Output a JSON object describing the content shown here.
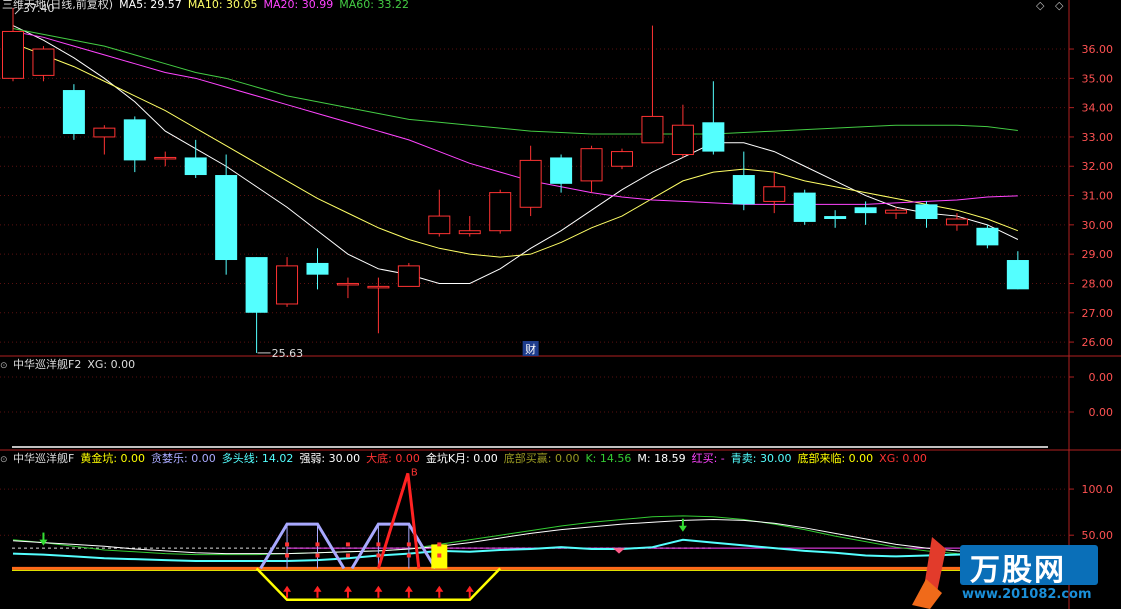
{
  "main": {
    "title": "三维天地(日线,前复权)",
    "ma": [
      {
        "label": "MA5: 29.57",
        "color": "#ffffff"
      },
      {
        "label": "MA10: 30.05",
        "color": "#ffff66"
      },
      {
        "label": "MA20: 30.99",
        "color": "#ff44ff"
      },
      {
        "label": "MA60: 33.22",
        "color": "#44cc44"
      }
    ],
    "high_label": "37.40",
    "low_label": "25.63",
    "event_marker": "财",
    "y_ticks": [
      "36.00",
      "35.00",
      "34.00",
      "33.00",
      "32.00",
      "31.00",
      "30.00",
      "29.00",
      "28.00",
      "27.00",
      "26.00"
    ],
    "y_tick_values": [
      36,
      35,
      34,
      33,
      32,
      31,
      30,
      29,
      28,
      27,
      26
    ],
    "price_range": [
      25.9,
      37.4
    ],
    "up_color": "#ff3333",
    "down_color": "#54ffff"
  },
  "panel2": {
    "title": "中华巡洋舰F2",
    "xg": "XG: 0.00",
    "y_ticks": [
      "0.00",
      "0.00"
    ]
  },
  "panel3": {
    "title": "中华巡洋舰F",
    "items": [
      {
        "label": "黄金坑:",
        "value": "0.00",
        "color": "#ffff00"
      },
      {
        "label": "贪婪乐:",
        "value": "0.00",
        "color": "#aaaaff"
      },
      {
        "label": "多头线:",
        "value": "14.02",
        "color": "#54ffff"
      },
      {
        "label": "强弱:",
        "value": "30.00",
        "color": "#ffffff"
      },
      {
        "label": "大底:",
        "value": "0.00",
        "color": "#ff3333"
      },
      {
        "label": "金坑K月:",
        "value": "0.00",
        "color": "#ffffff"
      },
      {
        "label": "底部买赢:",
        "value": "0.00",
        "color": "#999922"
      },
      {
        "label": "K:",
        "value": "14.56",
        "color": "#33cc33"
      },
      {
        "label": "M:",
        "value": "18.59",
        "color": "#ffffff"
      },
      {
        "label": "红买:",
        "value": "-",
        "color": "#ff44ff"
      },
      {
        "label": "青卖:",
        "value": "30.00",
        "color": "#54ffff"
      },
      {
        "label": "底部来临:",
        "value": "0.00",
        "color": "#ffff00"
      },
      {
        "label": "XG:",
        "value": "0.00",
        "color": "#ff3333"
      }
    ],
    "y_ticks": [
      "100.0",
      "50.00"
    ],
    "y_tick_values": [
      100,
      50
    ],
    "b_marker": "B"
  },
  "watermark": {
    "brand": "万股网",
    "url": "www.201082.com"
  },
  "candles": [
    {
      "o": 35.0,
      "c": 36.6,
      "h": 37.4,
      "l": 34.9
    },
    {
      "o": 35.1,
      "c": 36.0,
      "h": 36.1,
      "l": 34.9
    },
    {
      "o": 34.6,
      "c": 33.1,
      "h": 34.8,
      "l": 32.9
    },
    {
      "o": 33.0,
      "c": 33.3,
      "h": 33.4,
      "l": 32.4
    },
    {
      "o": 33.6,
      "c": 32.2,
      "h": 33.7,
      "l": 31.8
    },
    {
      "o": 32.3,
      "c": 32.3,
      "h": 32.5,
      "l": 32.0
    },
    {
      "o": 32.3,
      "c": 31.7,
      "h": 32.9,
      "l": 31.6
    },
    {
      "o": 31.7,
      "c": 28.8,
      "h": 32.4,
      "l": 28.3
    },
    {
      "o": 28.9,
      "c": 27.0,
      "h": 28.9,
      "l": 25.63
    },
    {
      "o": 27.3,
      "c": 28.6,
      "h": 28.9,
      "l": 27.2
    },
    {
      "o": 28.7,
      "c": 28.3,
      "h": 29.2,
      "l": 27.8
    },
    {
      "o": 28.0,
      "c": 28.0,
      "h": 28.2,
      "l": 27.5
    },
    {
      "o": 27.9,
      "c": 27.9,
      "h": 28.2,
      "l": 26.3
    },
    {
      "o": 27.9,
      "c": 28.6,
      "h": 28.7,
      "l": 27.9
    },
    {
      "o": 29.7,
      "c": 30.3,
      "h": 31.2,
      "l": 29.6
    },
    {
      "o": 29.7,
      "c": 29.8,
      "h": 30.3,
      "l": 29.6
    },
    {
      "o": 29.8,
      "c": 31.1,
      "h": 31.2,
      "l": 29.7
    },
    {
      "o": 30.6,
      "c": 32.2,
      "h": 32.7,
      "l": 30.3
    },
    {
      "o": 32.3,
      "c": 31.4,
      "h": 32.4,
      "l": 31.1
    },
    {
      "o": 31.5,
      "c": 32.6,
      "h": 32.7,
      "l": 31.1
    },
    {
      "o": 32.0,
      "c": 32.5,
      "h": 32.6,
      "l": 31.9
    },
    {
      "o": 32.8,
      "c": 33.7,
      "h": 36.8,
      "l": 32.8
    },
    {
      "o": 32.4,
      "c": 33.4,
      "h": 34.1,
      "l": 32.3
    },
    {
      "o": 33.5,
      "c": 32.5,
      "h": 34.9,
      "l": 32.4
    },
    {
      "o": 31.7,
      "c": 30.7,
      "h": 32.5,
      "l": 30.5
    },
    {
      "o": 30.8,
      "c": 31.3,
      "h": 31.8,
      "l": 30.4
    },
    {
      "o": 31.1,
      "c": 30.1,
      "h": 31.2,
      "l": 30.0
    },
    {
      "o": 30.3,
      "c": 30.2,
      "h": 30.5,
      "l": 29.9
    },
    {
      "o": 30.6,
      "c": 30.4,
      "h": 30.8,
      "l": 30.0
    },
    {
      "o": 30.4,
      "c": 30.5,
      "h": 30.6,
      "l": 30.2
    },
    {
      "o": 30.7,
      "c": 30.2,
      "h": 30.8,
      "l": 29.9
    },
    {
      "o": 30.0,
      "c": 30.2,
      "h": 30.4,
      "l": 29.8
    },
    {
      "o": 29.9,
      "c": 29.3,
      "h": 30.0,
      "l": 29.2
    },
    {
      "o": 28.8,
      "c": 27.8,
      "h": 29.1,
      "l": 27.8
    }
  ],
  "ma_series": {
    "ma5": [
      36.8,
      36.3,
      35.7,
      35.0,
      34.2,
      33.2,
      32.6,
      32.0,
      31.3,
      30.6,
      29.8,
      29.0,
      28.5,
      28.3,
      28.0,
      28.0,
      28.5,
      29.2,
      29.8,
      30.5,
      31.2,
      31.8,
      32.3,
      32.8,
      32.8,
      32.5,
      32.0,
      31.5,
      31.0,
      30.6,
      30.4,
      30.3,
      30.0,
      29.5
    ],
    "ma10": [
      36.2,
      35.8,
      35.4,
      34.9,
      34.4,
      33.9,
      33.3,
      32.7,
      32.1,
      31.5,
      30.9,
      30.4,
      29.9,
      29.5,
      29.2,
      29.0,
      28.9,
      29.0,
      29.4,
      29.9,
      30.3,
      30.9,
      31.5,
      31.8,
      31.9,
      31.8,
      31.5,
      31.3,
      31.1,
      30.9,
      30.7,
      30.5,
      30.2,
      29.8
    ],
    "ma20": [
      36.6,
      36.4,
      36.1,
      35.8,
      35.5,
      35.2,
      35.0,
      34.7,
      34.4,
      34.1,
      33.8,
      33.5,
      33.2,
      32.9,
      32.5,
      32.1,
      31.8,
      31.5,
      31.3,
      31.1,
      30.95,
      30.85,
      30.8,
      30.75,
      30.7,
      30.7,
      30.7,
      30.7,
      30.7,
      30.75,
      30.8,
      30.85,
      30.95,
      30.99
    ],
    "ma60": [
      36.7,
      36.5,
      36.3,
      36.1,
      35.8,
      35.5,
      35.2,
      35.0,
      34.7,
      34.4,
      34.2,
      34.0,
      33.8,
      33.6,
      33.5,
      33.4,
      33.3,
      33.2,
      33.15,
      33.1,
      33.1,
      33.1,
      33.1,
      33.1,
      33.15,
      33.2,
      33.25,
      33.3,
      33.35,
      33.4,
      33.4,
      33.4,
      33.35,
      33.22
    ]
  },
  "indicator": {
    "white": [
      44,
      42,
      40,
      38,
      35,
      33,
      31,
      30,
      30,
      30,
      31,
      32,
      33,
      35,
      38,
      42,
      47,
      52,
      56,
      59,
      62,
      64,
      66,
      67,
      66,
      63,
      58,
      52,
      46,
      40,
      36,
      33,
      31,
      30
    ],
    "green": [
      45,
      42,
      38,
      34,
      32,
      30,
      29,
      29,
      29,
      30,
      31,
      32,
      33,
      35,
      40,
      45,
      50,
      55,
      60,
      64,
      67,
      70,
      71,
      70,
      67,
      62,
      56,
      49,
      43,
      37,
      33,
      30,
      28,
      26
    ],
    "cyan": [
      30,
      29,
      27,
      25,
      24,
      23,
      22,
      22,
      22,
      22,
      23,
      25,
      28,
      30,
      33,
      32,
      34,
      35,
      37,
      35,
      35,
      37,
      45,
      42,
      39,
      36,
      33,
      31,
      28,
      27,
      28,
      29,
      30,
      30
    ],
    "thick_level": 14,
    "pink_level": 36,
    "dash_level": 36,
    "lilac_peaks": [
      9,
      10,
      12,
      13
    ],
    "red_peak_index": 13,
    "red_peak_value": 117,
    "yellow_bar_index": 14,
    "yellow_bar_value": 40,
    "arrows_indices": [
      9,
      10,
      11,
      12,
      13,
      14,
      15
    ],
    "green_arrow_indices": [
      1,
      22
    ],
    "low_bracket": [
      8,
      16
    ],
    "low_bracket_level": -20,
    "range": [
      -30,
      125
    ]
  }
}
